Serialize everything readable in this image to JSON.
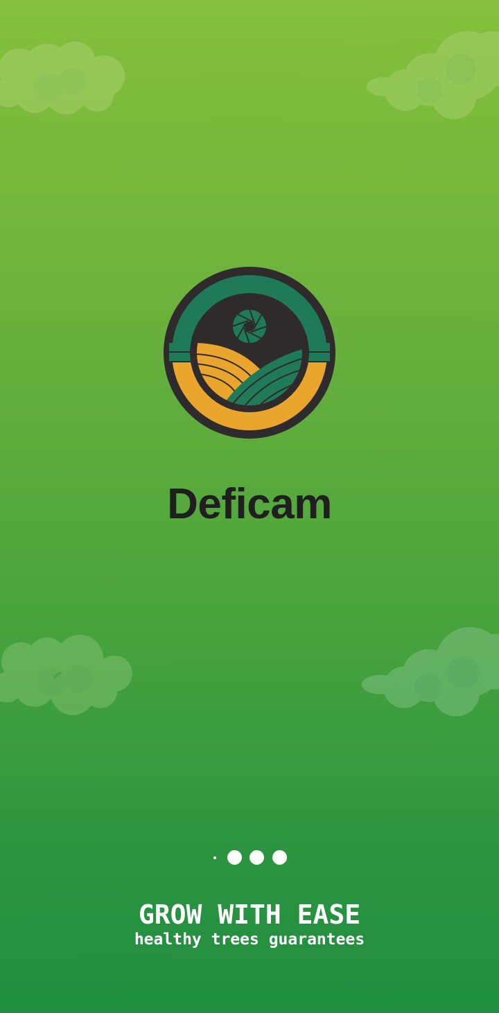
{
  "background": {
    "gradient_top": "#86c03c",
    "gradient_bottom": "#1f8d3f"
  },
  "logo": {
    "icon": "camera-field-logo",
    "colors": {
      "ring_dark": "#2f2a2b",
      "teal": "#1f7a5a",
      "orange": "#eaa52c"
    }
  },
  "app": {
    "name": "Deficam"
  },
  "pager": {
    "page_count": 4,
    "active_index": 0
  },
  "onboarding": {
    "headline": "GROW WITH EASE",
    "tagline": "healthy trees guarantees"
  }
}
